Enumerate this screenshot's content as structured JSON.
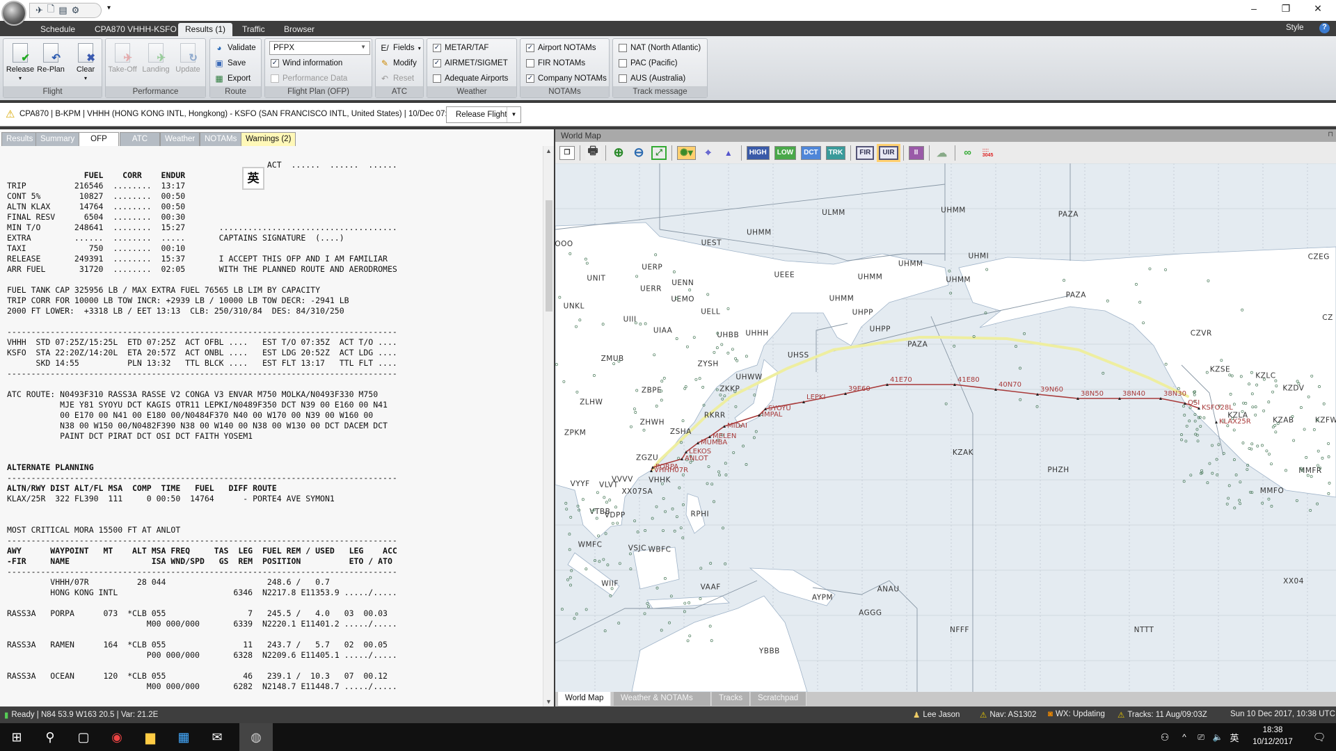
{
  "window": {
    "minimize": "–",
    "restore": "❐",
    "close": "✕",
    "style_label": "Style",
    "help": "?"
  },
  "ribbon_tabs": [
    "Schedule",
    "CPA870 VHHH-KSFO",
    "Results (1)",
    "Traffic",
    "Browser"
  ],
  "ribbon": {
    "flight": {
      "label": "Flight",
      "release": "Release",
      "replan": "Re-Plan",
      "clear": "Clear"
    },
    "performance": {
      "label": "Performance",
      "takeoff": "Take-Off",
      "landing": "Landing",
      "update": "Update"
    },
    "route": {
      "label": "Route",
      "validate": "Validate",
      "save": "Save",
      "export": "Export"
    },
    "flightplan": {
      "label": "Flight Plan (OFP)",
      "format": "PFPX",
      "wind": "Wind information",
      "wind_checked": true,
      "perf": "Performance Data",
      "perf_checked": false
    },
    "atc": {
      "label": "ATC",
      "fields": "Fields",
      "modify": "Modify",
      "reset": "Reset"
    },
    "weather": {
      "label": "Weather",
      "items": [
        {
          "label": "METAR/TAF",
          "checked": true
        },
        {
          "label": "AIRMET/SIGMET",
          "checked": true
        },
        {
          "label": "Adequate Airports",
          "checked": false
        }
      ]
    },
    "notams": {
      "label": "NOTAMs",
      "items": [
        {
          "label": "Airport NOTAMs",
          "checked": true
        },
        {
          "label": "FIR NOTAMs",
          "checked": false
        },
        {
          "label": "Company NOTAMs",
          "checked": true
        }
      ]
    },
    "tracks": {
      "label": "Track message",
      "items": [
        {
          "label": "NAT (North Atlantic)",
          "checked": false
        },
        {
          "label": "PAC (Pacific)",
          "checked": false
        },
        {
          "label": "AUS (Australia)",
          "checked": false
        }
      ]
    }
  },
  "infobar": {
    "text": "CPA870 | B-KPM | VHHH (HONG KONG INTL, Hongkong) - KSFO (SAN FRANCISCO INTL, United States) | 10/Dec 07:25UTC",
    "release_button": "Release Flight"
  },
  "result_tabs": [
    "Results",
    "Summary",
    "OFP",
    "ATC",
    "Weather",
    "NOTAMs",
    "Warnings (2)"
  ],
  "ime_indicator": "英",
  "ofp": {
    "lines": [
      {
        "t": "                                                      ACT  ......  ......  ......",
        "b": false
      },
      {
        "t": "                FUEL    CORR    ENDUR",
        "b": true
      },
      {
        "t": "TRIP          216546  ........  13:17",
        "b": false
      },
      {
        "t": "CONT 5%        10827  ........  00:50",
        "b": false
      },
      {
        "t": "ALTN KLAX      14764  ........  00:50",
        "b": false
      },
      {
        "t": "FINAL RESV      6504  ........  00:30",
        "b": false
      },
      {
        "t": "MIN T/O       248641  ........  15:27       .....................................",
        "b": false
      },
      {
        "t": "EXTRA         ......  ........  .....       CAPTAINS SIGNATURE  (....)",
        "b": false
      },
      {
        "t": "TAXI             750  ........  00:10",
        "b": false
      },
      {
        "t": "RELEASE       249391  ........  15:37       I ACCEPT THIS OFP AND I AM FAMILIAR",
        "b": false
      },
      {
        "t": "ARR FUEL       31720  ........  02:05       WITH THE PLANNED ROUTE AND AERODROMES",
        "b": false
      },
      {
        "t": "",
        "b": false
      },
      {
        "t": "FUEL TANK CAP 325956 LB / MAX EXTRA FUEL 76565 LB LIM BY CAPACITY",
        "b": false
      },
      {
        "t": "TRIP CORR FOR 10000 LB TOW INCR: +2939 LB / 10000 LB TOW DECR: -2941 LB",
        "b": false
      },
      {
        "t": "2000 FT LOWER:  +3318 LB / EET 13:13  CLB: 250/310/84  DES: 84/310/250",
        "b": false
      },
      {
        "t": "",
        "b": false
      },
      {
        "t": "---------------------------------------------------------------------------------",
        "b": false
      },
      {
        "t": "VHHH  STD 07:25Z/15:25L  ETD 07:25Z  ACT OFBL ....   EST T/O 07:35Z  ACT T/O ....",
        "b": false
      },
      {
        "t": "KSFO  STA 22:20Z/14:20L  ETA 20:57Z  ACT ONBL ....   EST LDG 20:52Z  ACT LDG ....",
        "b": false
      },
      {
        "t": "      SKD 14:55          PLN 13:32   TTL BLCK ....   EST FLT 13:17   TTL FLT ....",
        "b": false
      },
      {
        "t": "---------------------------------------------------------------------------------",
        "b": false
      },
      {
        "t": "",
        "b": false
      },
      {
        "t": "ATC ROUTE: N0493F310 RASS3A RASSE V2 CONGA V3 ENVAR M750 MOLKA/N0493F330 M750",
        "b": false
      },
      {
        "t": "           MJE Y81 SYOYU DCT KAGIS OTR11 LEPKI/N0489F350 DCT N39 00 E160 00 N41",
        "b": false
      },
      {
        "t": "           00 E170 00 N41 00 E180 00/N0484F370 N40 00 W170 00 N39 00 W160 00",
        "b": false
      },
      {
        "t": "           N38 00 W150 00/N0482F390 N38 00 W140 00 N38 00 W130 00 DCT DACEM DCT",
        "b": false
      },
      {
        "t": "           PAINT DCT PIRAT DCT OSI DCT FAITH YOSEM1",
        "b": false
      },
      {
        "t": "",
        "b": false
      },
      {
        "t": "",
        "b": false
      },
      {
        "t": "ALTERNATE PLANNING",
        "b": true
      },
      {
        "t": "---------------------------------------------------------------------------------",
        "b": false
      },
      {
        "t": "ALTN/RWY DIST ALT/FL MSA  COMP  TIME   FUEL   DIFF ROUTE",
        "b": true
      },
      {
        "t": "KLAX/25R  322 FL390  111     0 00:50  14764      - PORTE4 AVE SYMON1",
        "b": false
      },
      {
        "t": "",
        "b": false
      },
      {
        "t": "",
        "b": false
      },
      {
        "t": "MOST CRITICAL MORA 15500 FT AT ANLOT",
        "b": false
      },
      {
        "t": "---------------------------------------------------------------------------------",
        "b": false
      },
      {
        "t": "AWY      WAYPOINT   MT    ALT MSA FREQ     TAS  LEG  FUEL REM / USED   LEG    ACC",
        "b": true
      },
      {
        "t": "-FIR     NAME                 ISA WND/SPD   GS  REM  POSITION          ETO / ATO",
        "b": true
      },
      {
        "t": "---------------------------------------------------------------------------------",
        "b": false
      },
      {
        "t": "         VHHH/07R          28 044                     248.6 /   0.7",
        "b": false
      },
      {
        "t": "         HONG KONG INTL                        6346  N2217.8 E11353.9 ...../.....",
        "b": false
      },
      {
        "t": "",
        "b": false
      },
      {
        "t": "RASS3A   PORPA      073  *CLB 055                 7   245.5 /   4.0   03  00.03",
        "b": false
      },
      {
        "t": "                             M00 000/000       6339  N2220.1 E11401.2 ...../.....",
        "b": false
      },
      {
        "t": "",
        "b": false
      },
      {
        "t": "RASS3A   RAMEN      164  *CLB 055                11   243.7 /   5.7   02  00.05",
        "b": false
      },
      {
        "t": "                             P00 000/000       6328  N2209.6 E11405.1 ...../.....",
        "b": false
      },
      {
        "t": "",
        "b": false
      },
      {
        "t": "RASS3A   OCEAN      120  *CLB 055                46   239.1 /  10.3   07  00.12",
        "b": false
      },
      {
        "t": "                             M00 000/000       6282  N2148.7 E11448.7 ...../.....",
        "b": false
      }
    ]
  },
  "map": {
    "title": "World Map",
    "toolbar": [
      {
        "label": "HIGH",
        "color": "#3a5aa8"
      },
      {
        "label": "LOW",
        "color": "#4aa84a"
      },
      {
        "label": "DCT",
        "color": "#4f86d8"
      },
      {
        "label": "TRK",
        "color": "#3a9a9a"
      },
      {
        "label": "FIR",
        "color": "#e8e8f4"
      },
      {
        "label": "UIR",
        "color": "#e8e8f4"
      },
      {
        "label": "II",
        "color": "#9a5aa8"
      }
    ],
    "fir_labels": [
      "ULMM",
      "UHMM",
      "UEST",
      "UERP",
      "UNIT",
      "UENN",
      "UERR",
      "UEMO",
      "UELL",
      "UNKL",
      "UIII",
      "UIAA",
      "UHBB",
      "UHHH",
      "UEEE",
      "UHMM",
      "UHMM",
      "UHMM",
      "UHPP",
      "UHPP",
      "PAZA",
      "UHSS",
      "ZMUB",
      "ZYSH",
      "UHWW",
      "ZBPE",
      "ZKKP",
      "ZLHW",
      "ZHWH",
      "RKRR",
      "ZSHA",
      "ZPKM",
      "JOOO",
      "UHMM",
      "PAZA",
      "UHMI",
      "UHMM",
      "PAZA",
      "CZEG",
      "CZVR",
      "KZSE",
      "KZLC",
      "KZDV",
      "KZLA",
      "KZAB",
      "KZFW",
      "ZGZU",
      "VHHK",
      "VYYF",
      "VLVT",
      "VVVV",
      "XX07SA",
      "VTBB",
      "VDPP",
      "RPHI",
      "WMFC",
      "VSJC",
      "WBFC",
      "WIIF",
      "VAAF",
      "AYPM",
      "ANAU",
      "AGGG",
      "YBBB",
      "KZAK",
      "PHZH",
      "MMFR",
      "MMFO",
      "NFFF",
      "NTTT",
      "XX04",
      "CZ"
    ],
    "waypoints": [
      "VHHH07R",
      "PORPA",
      "ANLOT",
      "LEKOS",
      "MUMBA",
      "MELEN",
      "MIDAI",
      "IMPAL",
      "SYOYU",
      "LEPKI",
      "39E60",
      "41E70",
      "41E80",
      "40N70",
      "39N60",
      "38N50",
      "38N40",
      "38N30",
      "OSI",
      "KSFO28L",
      "KLAX25R"
    ],
    "route_color": "#a83a3a",
    "great_circle_color": "#eeeea0",
    "bottom_tabs": [
      "World Map",
      "Weather & NOTAMs",
      "Tracks",
      "Scratchpad"
    ]
  },
  "status": {
    "left": "Ready | N84 53.9 W163 20.5 | Var: 21.2E",
    "user": "Lee Jason",
    "nav": "Nav: AS1302",
    "wx": "WX: Updating",
    "tracks": "Tracks: 11 Aug/09:03Z",
    "datetime": "Sun 10 Dec 2017, 10:38 UTC"
  },
  "taskbar": {
    "time": "18:38",
    "date": "10/12/2017",
    "ime": "英"
  }
}
